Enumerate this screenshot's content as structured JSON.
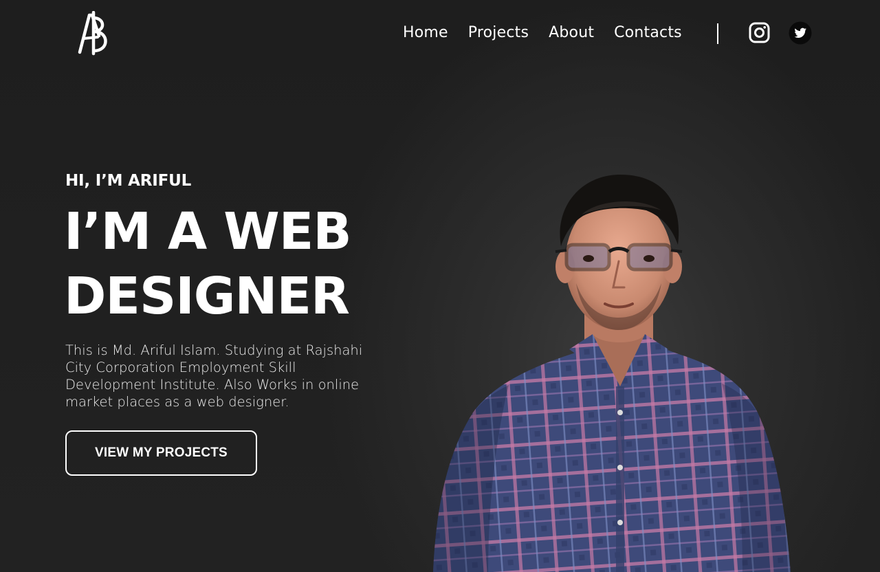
{
  "nav": {
    "items": [
      "Home",
      "Projects",
      "About",
      "Contacts"
    ]
  },
  "hero": {
    "greeting": "HI, I’M ARIFUL",
    "headline_line1": "I’M A WEB",
    "headline_line2": "DESIGNER",
    "description": "This is Md. Ariful Islam. Studying at Rajshahi City Corporation Employment Skill Development Institute. Also Works in online market places as a web designer.",
    "cta_label": "VIEW MY PROJECTS"
  },
  "icons": {
    "logo": "ab-monogram-logo",
    "social": [
      "instagram-icon",
      "twitter-icon"
    ]
  },
  "colors": {
    "background": "#1f1f1f",
    "text": "#ffffff",
    "shirt": "#3e4a7a",
    "shirt_check": "#c77aa6"
  }
}
